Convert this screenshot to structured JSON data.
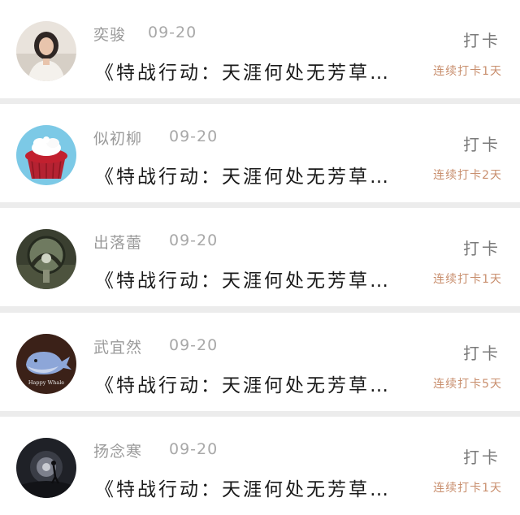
{
  "items": [
    {
      "name": "奕骏",
      "date": "09-20",
      "action": "打卡",
      "title": "《特战行动：天涯何处无芳草…",
      "streak": "连续打卡1天",
      "avatar": "avatar-portrait-woman"
    },
    {
      "name": "似初柳",
      "date": "09-20",
      "action": "打卡",
      "title": "《特战行动：天涯何处无芳草…",
      "streak": "连续打卡2天",
      "avatar": "avatar-cupcake"
    },
    {
      "name": "出落蕾",
      "date": "09-20",
      "action": "打卡",
      "title": "《特战行动：天涯何处无芳草…",
      "streak": "连续打卡1天",
      "avatar": "avatar-sphere-landscape"
    },
    {
      "name": "武宜然",
      "date": "09-20",
      "action": "打卡",
      "title": "《特战行动：天涯何处无芳草…",
      "streak": "连续打卡5天",
      "avatar": "avatar-happy-whale",
      "avatar_caption": "Happy Whale"
    },
    {
      "name": "扬念寒",
      "date": "09-20",
      "action": "打卡",
      "title": "《特战行动：天涯何处无芳草…",
      "streak": "连续打卡1天",
      "avatar": "avatar-dark-figure"
    }
  ],
  "colors": {
    "name": "#9a9a9a",
    "title": "#1a1a1a",
    "streak": "#c88e6d",
    "action": "#7a7a7a"
  }
}
